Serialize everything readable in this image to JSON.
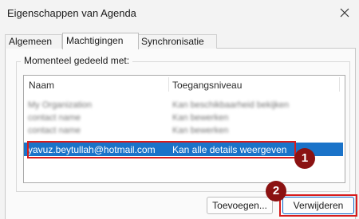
{
  "window": {
    "title": "Eigenschappen van Agenda",
    "close_icon": "close-icon"
  },
  "tabs": [
    {
      "label": "Algemeen",
      "active": false
    },
    {
      "label": "Machtigingen",
      "active": true
    },
    {
      "label": "Synchronisatie",
      "active": false
    }
  ],
  "shared_group": {
    "label": "Momenteel gedeeld met:",
    "columns": [
      "Naam",
      "Toegangsniveau"
    ],
    "rows": [
      {
        "name": "My Organization",
        "access": "Kan beschikbaarheid bekijken",
        "blurred": true,
        "selected": false
      },
      {
        "name": "contact name",
        "access": "Kan bewerken",
        "blurred": true,
        "selected": false
      },
      {
        "name": "contact name",
        "access": "Kan bewerken",
        "blurred": true,
        "selected": false
      },
      {
        "name": "yavuz.beytullah@hotmail.com",
        "access": "Kan alle details weergeven",
        "blurred": false,
        "selected": true
      }
    ]
  },
  "buttons": {
    "add": "Toevoegen...",
    "remove": "Verwijderen"
  },
  "annotations": {
    "badge1": "1",
    "badge2": "2",
    "color": "#d81b1b",
    "badge_color": "#8b1212"
  },
  "colors": {
    "selection": "#1a73c9"
  }
}
